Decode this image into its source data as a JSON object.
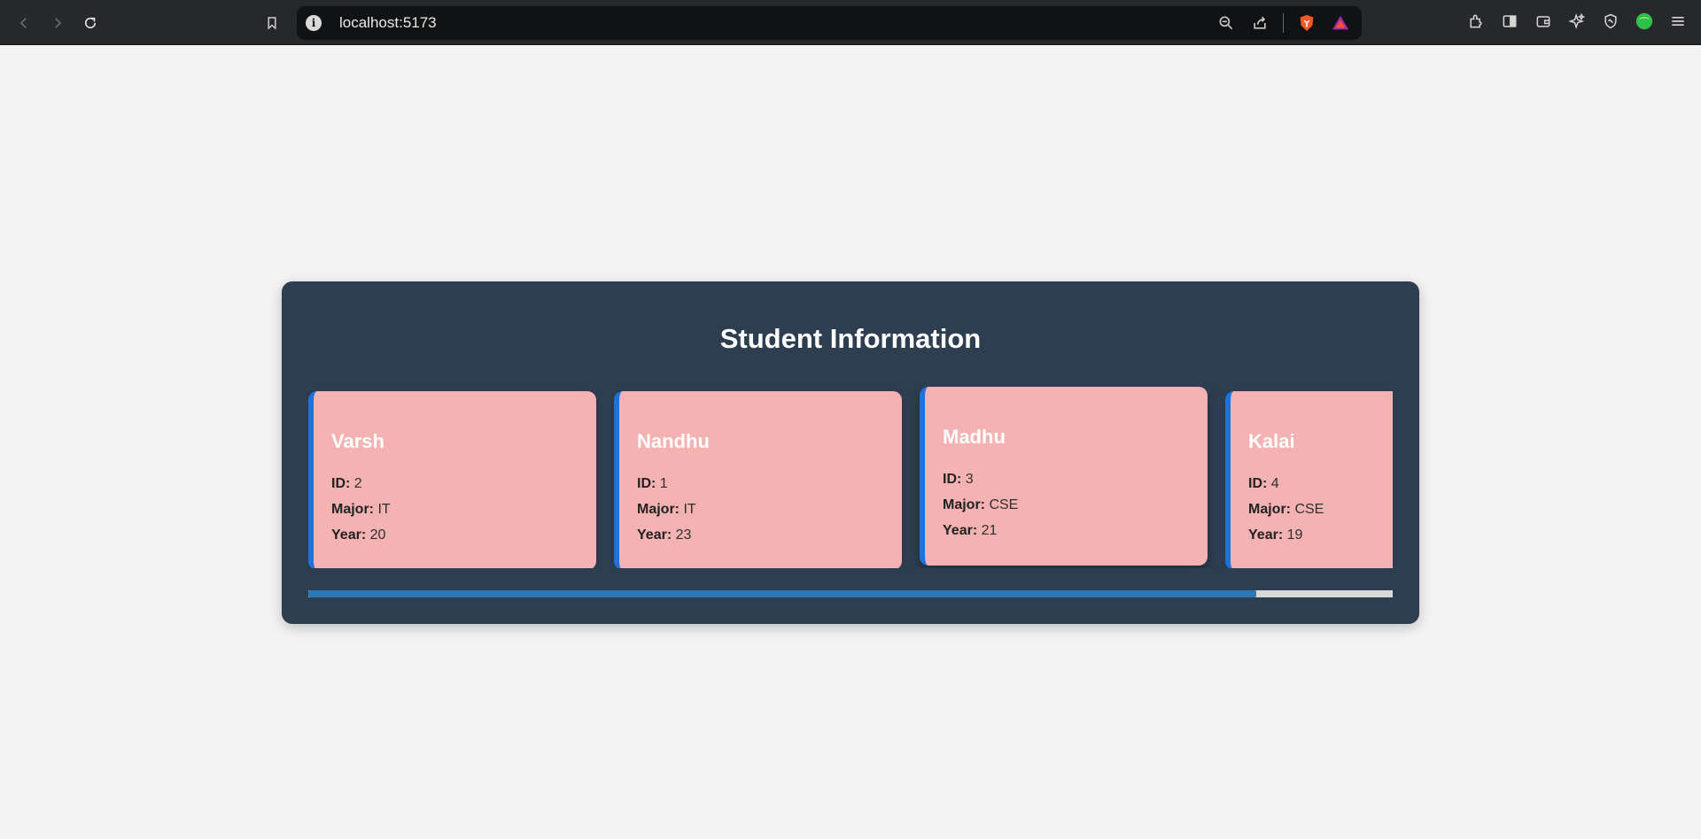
{
  "browser": {
    "url": "localhost:5173",
    "info_icon": "i"
  },
  "main": {
    "title": "Student Information",
    "students": [
      {
        "name": "Varsh",
        "id_label": "ID:",
        "id": "2",
        "major_label": "Major:",
        "major": "IT",
        "year_label": "Year:",
        "year": "20"
      },
      {
        "name": "Nandhu",
        "id_label": "ID:",
        "id": "1",
        "major_label": "Major:",
        "major": "IT",
        "year_label": "Year:",
        "year": "23"
      },
      {
        "name": "Madhu",
        "id_label": "ID:",
        "id": "3",
        "major_label": "Major:",
        "major": "CSE",
        "year_label": "Year:",
        "year": "21"
      },
      {
        "name": "Kalai",
        "id_label": "ID:",
        "id": "4",
        "major_label": "Major:",
        "major": "CSE",
        "year_label": "Year:",
        "year": "19"
      }
    ],
    "scrollbar_thumb_fraction": 0.874
  },
  "colors": {
    "panel_bg": "#2e3e51",
    "card_bg": "#f4b2b2",
    "card_accent": "#1d73db",
    "scroll_thumb": "#2d78b9"
  }
}
